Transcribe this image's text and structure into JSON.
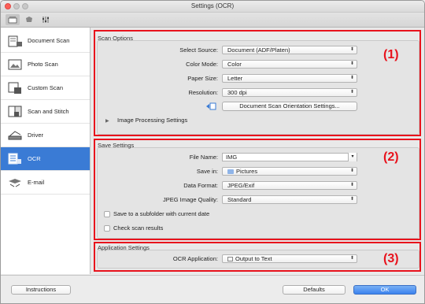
{
  "window": {
    "title": "Settings (OCR)"
  },
  "toolbar": {
    "tabs": [
      "scanner-icon",
      "gear-icon",
      "sliders-icon"
    ]
  },
  "sidebar": {
    "items": [
      {
        "label": "Document Scan",
        "icon": "document-scan-icon"
      },
      {
        "label": "Photo Scan",
        "icon": "photo-scan-icon"
      },
      {
        "label": "Custom Scan",
        "icon": "custom-scan-icon"
      },
      {
        "label": "Scan and Stitch",
        "icon": "scan-stitch-icon"
      },
      {
        "label": "Driver",
        "icon": "driver-icon"
      },
      {
        "label": "OCR",
        "icon": "ocr-icon",
        "selected": true
      },
      {
        "label": "E-mail",
        "icon": "email-icon"
      }
    ]
  },
  "scan_options": {
    "title": "Scan Options",
    "callout": "(1)",
    "source_label": "Select Source:",
    "source_value": "Document (ADF/Platen)",
    "color_label": "Color Mode:",
    "color_value": "Color",
    "paper_label": "Paper Size:",
    "paper_value": "Letter",
    "resolution_label": "Resolution:",
    "resolution_value": "300 dpi",
    "orientation_button": "Document Scan Orientation Settings...",
    "image_processing": "Image Processing Settings"
  },
  "save_settings": {
    "title": "Save Settings",
    "callout": "(2)",
    "filename_label": "File Name:",
    "filename_value": "IMG",
    "savein_label": "Save in:",
    "savein_value": "Pictures",
    "format_label": "Data Format:",
    "format_value": "JPEG/Exif",
    "quality_label": "JPEG Image Quality:",
    "quality_value": "Standard",
    "subfolder_label": "Save to a subfolder with current date",
    "check_results_label": "Check scan results"
  },
  "application_settings": {
    "title": "Application Settings",
    "callout": "(3)",
    "ocr_label": "OCR Application:",
    "ocr_value": "Output to Text"
  },
  "footer": {
    "instructions": "Instructions",
    "defaults": "Defaults",
    "ok": "OK"
  },
  "colors": {
    "accent": "#3a7bd5",
    "callout": "#e8121c"
  }
}
